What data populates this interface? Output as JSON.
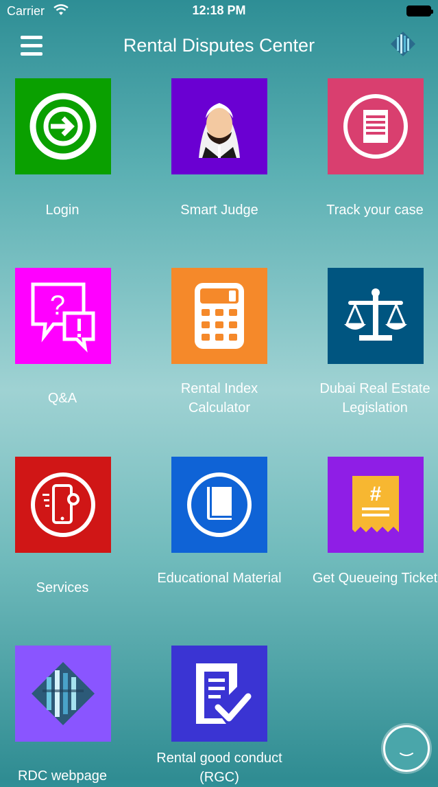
{
  "status_bar": {
    "carrier": "Carrier",
    "time": "12:18 PM"
  },
  "header": {
    "title": "Rental Disputes Center",
    "menu_icon": "hamburger-icon",
    "logo_icon": "rdc-logo-icon"
  },
  "tiles": [
    {
      "id": "login",
      "label": "Login",
      "color": "#0aa000",
      "icon": "login-icon"
    },
    {
      "id": "smart-judge",
      "label": "Smart Judge",
      "color": "#6a00d2",
      "icon": "judge-avatar-icon"
    },
    {
      "id": "track-case",
      "label": "Track your case",
      "color": "#d93f6f",
      "icon": "document-icon"
    },
    {
      "id": "qa",
      "label": "Q&A",
      "color": "#ff00ff",
      "icon": "question-bubbles-icon"
    },
    {
      "id": "rental-index",
      "label": "Rental Index Calculator",
      "color": "#f5892a",
      "icon": "calculator-icon"
    },
    {
      "id": "legislation",
      "label": "Dubai Real Estate Legislation",
      "color": "#005580",
      "icon": "scales-icon"
    },
    {
      "id": "services",
      "label": "Services",
      "color": "#d01616",
      "icon": "mobile-services-icon"
    },
    {
      "id": "educational",
      "label": "Educational Material",
      "color": "#0f63d6",
      "icon": "book-icon"
    },
    {
      "id": "queue-ticket",
      "label": "Get Queueing Ticket",
      "color": "#8f1ee6",
      "icon": "ticket-icon"
    },
    {
      "id": "rdc-webpage",
      "label": "RDC webpage",
      "color": "#8a55ff",
      "icon": "rdc-logo-icon"
    },
    {
      "id": "good-conduct",
      "label": "Rental good conduct (RGC)",
      "color": "#3a34d3",
      "icon": "document-check-icon"
    }
  ],
  "chat_button": {
    "icon": "chat-bubble-icon"
  }
}
